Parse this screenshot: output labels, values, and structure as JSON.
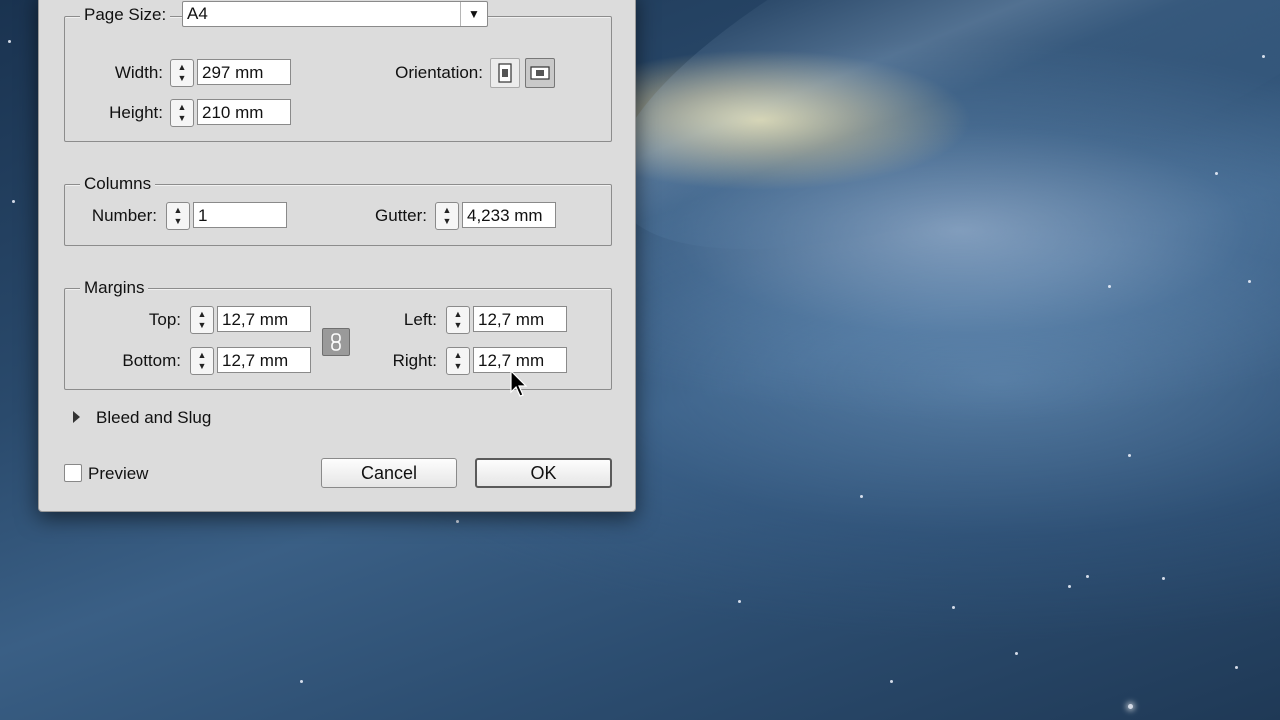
{
  "page_size": {
    "label": "Page Size:",
    "value": "A4"
  },
  "dimensions": {
    "width_label": "Width:",
    "width_value": "297 mm",
    "height_label": "Height:",
    "height_value": "210 mm",
    "orientation_label": "Orientation:",
    "orientation_selected": "landscape"
  },
  "columns": {
    "title": "Columns",
    "number_label": "Number:",
    "number_value": "1",
    "gutter_label": "Gutter:",
    "gutter_value": "4,233 mm"
  },
  "margins": {
    "title": "Margins",
    "top_label": "Top:",
    "top_value": "12,7 mm",
    "bottom_label": "Bottom:",
    "bottom_value": "12,7 mm",
    "left_label": "Left:",
    "left_value": "12,7 mm",
    "right_label": "Right:",
    "right_value": "12,7 mm"
  },
  "bleed": {
    "label": "Bleed and Slug"
  },
  "footer": {
    "preview_label": "Preview",
    "preview_checked": false,
    "cancel_label": "Cancel",
    "ok_label": "OK"
  }
}
